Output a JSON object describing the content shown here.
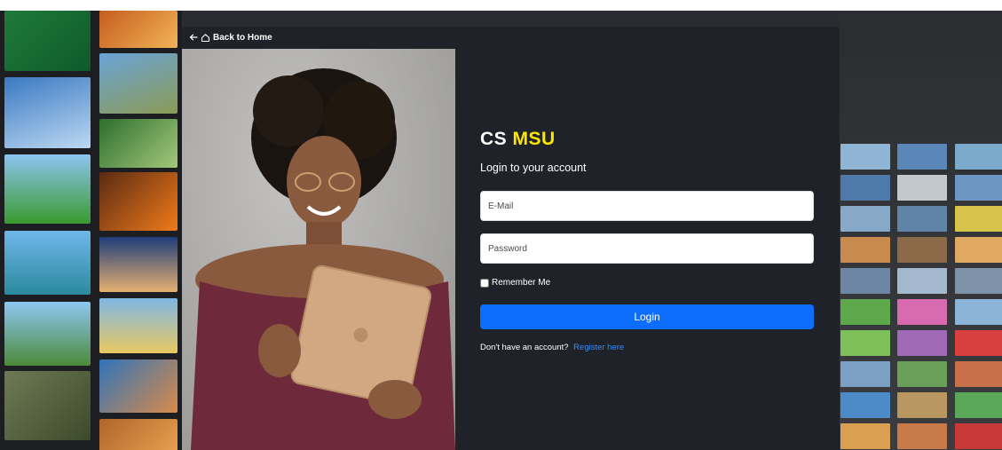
{
  "nav": {
    "back_label": "Back to Home"
  },
  "brand": {
    "part1": "CS",
    "part2": "MSU",
    "accent_color": "#ffe600"
  },
  "form": {
    "subtitle": "Login to your account",
    "email_placeholder": "E-Mail",
    "password_placeholder": "Password",
    "remember_label": "Remember Me",
    "remember_checked": false,
    "login_label": "Login",
    "register_prompt": "Don't have an account?",
    "register_link": "Register here"
  },
  "colors": {
    "primary_button": "#0d6efd",
    "card_bg": "#1f2229",
    "link": "#2f8cff"
  }
}
